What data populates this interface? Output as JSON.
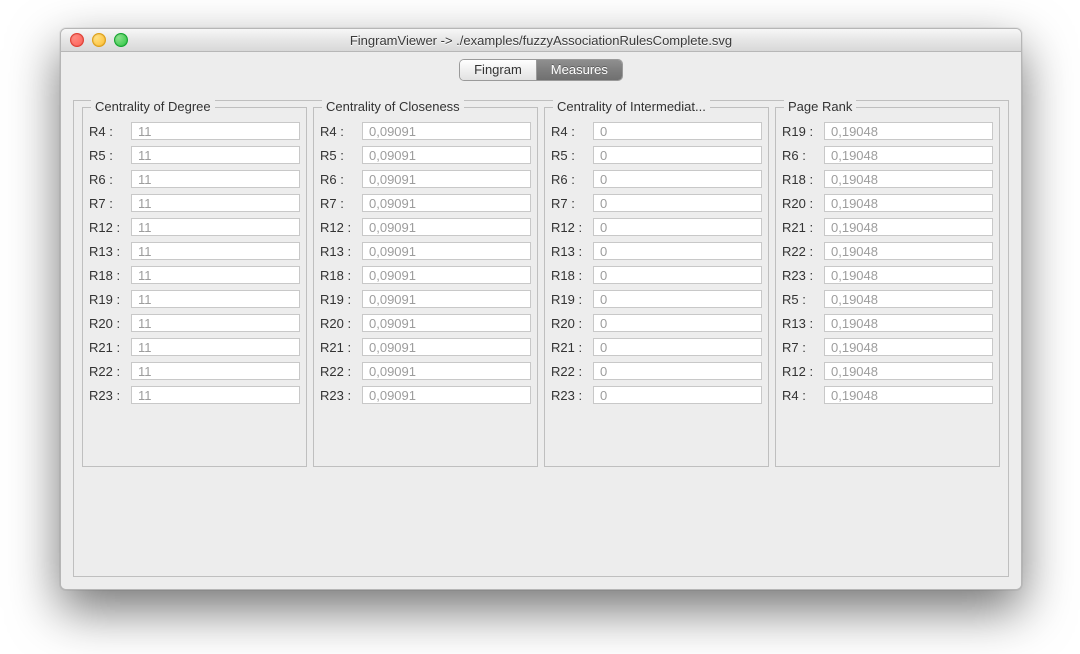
{
  "window": {
    "title": "FingramViewer -> ./examples/fuzzyAssociationRulesComplete.svg"
  },
  "tabs": {
    "fingram": "Fingram",
    "measures": "Measures",
    "active": "measures"
  },
  "groups": [
    {
      "title": "Centrality of Degree",
      "rows": [
        {
          "label": "R4 :",
          "value": "11"
        },
        {
          "label": "R5 :",
          "value": "11"
        },
        {
          "label": "R6 :",
          "value": "11"
        },
        {
          "label": "R7 :",
          "value": "11"
        },
        {
          "label": "R12 :",
          "value": "11"
        },
        {
          "label": "R13 :",
          "value": "11"
        },
        {
          "label": "R18 :",
          "value": "11"
        },
        {
          "label": "R19 :",
          "value": "11"
        },
        {
          "label": "R20 :",
          "value": "11"
        },
        {
          "label": "R21 :",
          "value": "11"
        },
        {
          "label": "R22 :",
          "value": "11"
        },
        {
          "label": "R23 :",
          "value": "11"
        }
      ]
    },
    {
      "title": "Centrality of Closeness",
      "rows": [
        {
          "label": "R4 :",
          "value": "0,09091"
        },
        {
          "label": "R5 :",
          "value": "0,09091"
        },
        {
          "label": "R6 :",
          "value": "0,09091"
        },
        {
          "label": "R7 :",
          "value": "0,09091"
        },
        {
          "label": "R12 :",
          "value": "0,09091"
        },
        {
          "label": "R13 :",
          "value": "0,09091"
        },
        {
          "label": "R18 :",
          "value": "0,09091"
        },
        {
          "label": "R19 :",
          "value": "0,09091"
        },
        {
          "label": "R20 :",
          "value": "0,09091"
        },
        {
          "label": "R21 :",
          "value": "0,09091"
        },
        {
          "label": "R22 :",
          "value": "0,09091"
        },
        {
          "label": "R23 :",
          "value": "0,09091"
        }
      ]
    },
    {
      "title": "Centrality of Intermediat...",
      "rows": [
        {
          "label": "R4 :",
          "value": "0"
        },
        {
          "label": "R5 :",
          "value": "0"
        },
        {
          "label": "R6 :",
          "value": "0"
        },
        {
          "label": "R7 :",
          "value": "0"
        },
        {
          "label": "R12 :",
          "value": "0"
        },
        {
          "label": "R13 :",
          "value": "0"
        },
        {
          "label": "R18 :",
          "value": "0"
        },
        {
          "label": "R19 :",
          "value": "0"
        },
        {
          "label": "R20 :",
          "value": "0"
        },
        {
          "label": "R21 :",
          "value": "0"
        },
        {
          "label": "R22 :",
          "value": "0"
        },
        {
          "label": "R23 :",
          "value": "0"
        }
      ]
    },
    {
      "title": "Page Rank",
      "rows": [
        {
          "label": "R19 :",
          "value": "0,19048"
        },
        {
          "label": "R6 :",
          "value": "0,19048"
        },
        {
          "label": "R18 :",
          "value": "0,19048"
        },
        {
          "label": "R20 :",
          "value": "0,19048"
        },
        {
          "label": "R21 :",
          "value": "0,19048"
        },
        {
          "label": "R22 :",
          "value": "0,19048"
        },
        {
          "label": "R23 :",
          "value": "0,19048"
        },
        {
          "label": "R5 :",
          "value": "0,19048"
        },
        {
          "label": "R13 :",
          "value": "0,19048"
        },
        {
          "label": "R7 :",
          "value": "0,19048"
        },
        {
          "label": "R12 :",
          "value": "0,19048"
        },
        {
          "label": "R4 :",
          "value": "0,19048"
        }
      ]
    }
  ]
}
